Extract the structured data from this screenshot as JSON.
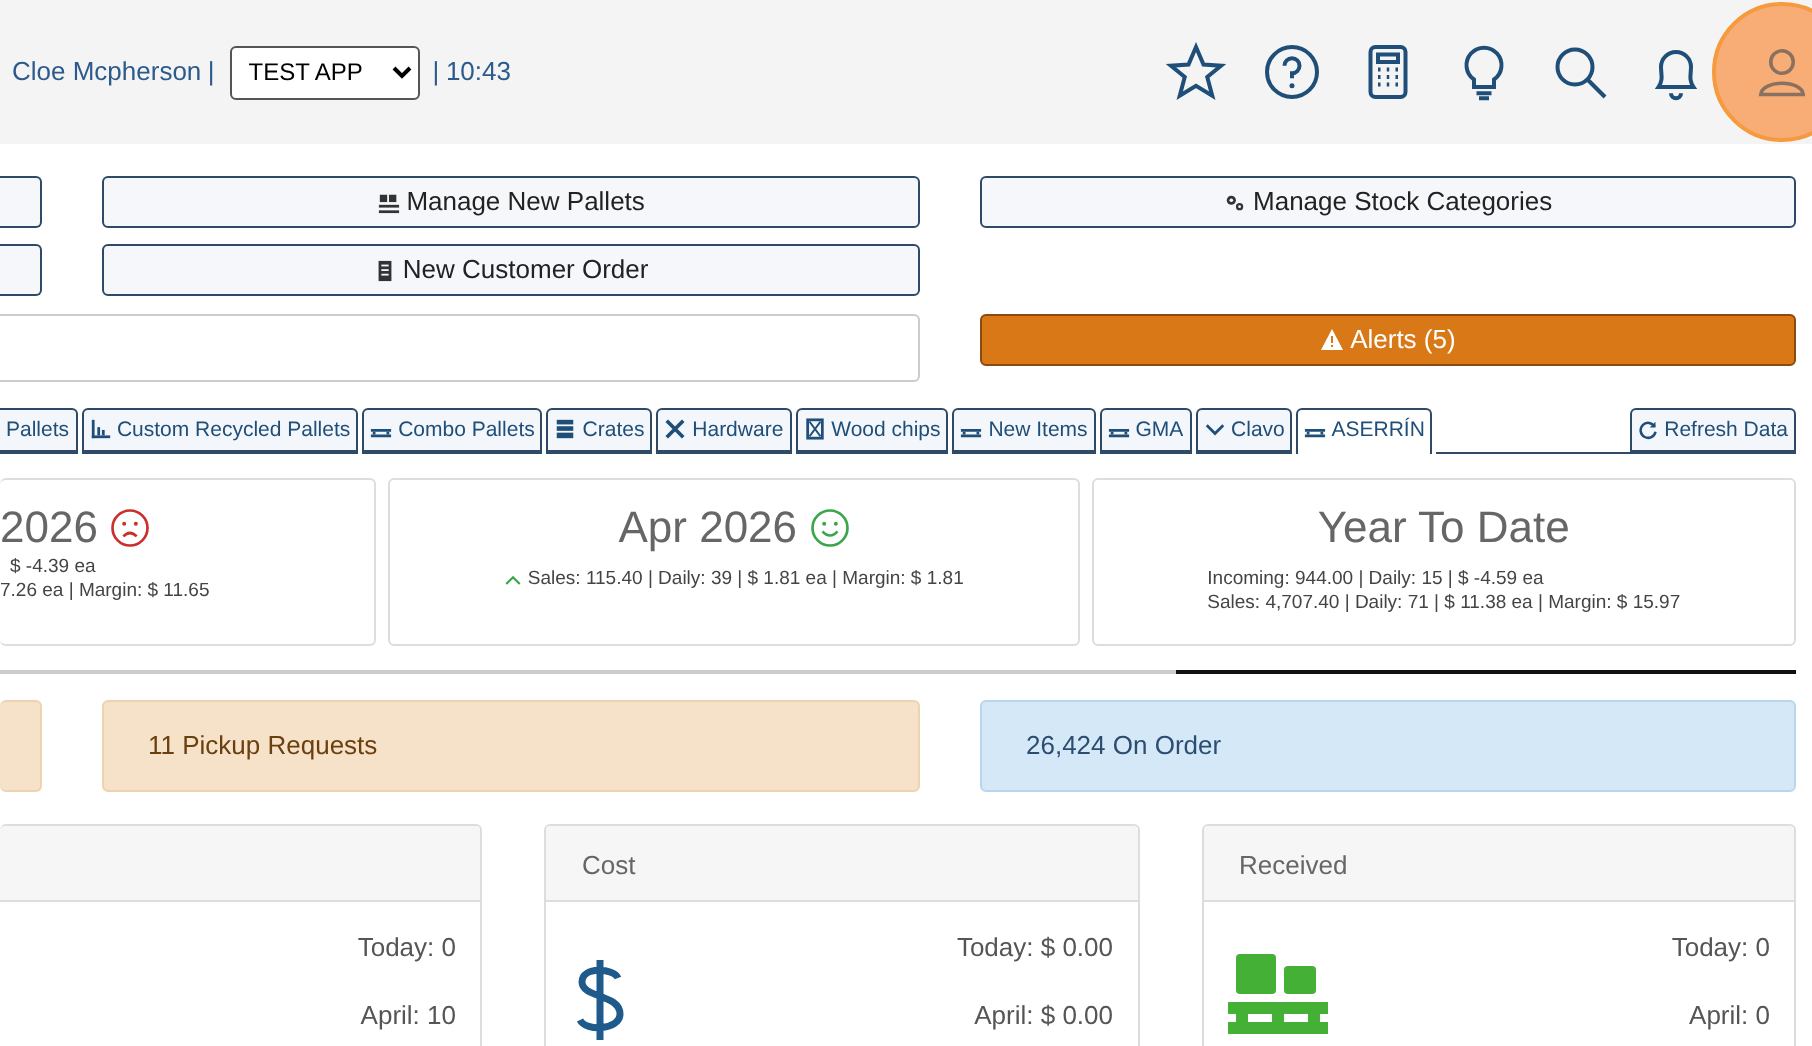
{
  "header": {
    "user": "Cloe Mcpherson",
    "separator_1": "|",
    "app_select": {
      "value": "TEST APP"
    },
    "separator_2": "|",
    "time": "10:43"
  },
  "action_buttons": [
    {
      "label": "Manage New Pallets"
    },
    {
      "label": "Manage Stock Categories"
    },
    {
      "label": "New Customer Order"
    }
  ],
  "alerts": {
    "label": "Alerts (5)"
  },
  "tabs": [
    {
      "label": "Pallets",
      "selected": false
    },
    {
      "label": "Custom Recycled Pallets",
      "selected": false
    },
    {
      "label": "Combo Pallets",
      "selected": false
    },
    {
      "label": "Crates",
      "selected": false
    },
    {
      "label": "Hardware",
      "selected": false
    },
    {
      "label": "Wood chips",
      "selected": false
    },
    {
      "label": "New Items",
      "selected": false
    },
    {
      "label": "GMA",
      "selected": false
    },
    {
      "label": "Clavo",
      "selected": false
    },
    {
      "label": "ASERRÍN",
      "selected": true
    }
  ],
  "refresh": {
    "label": "Refresh Data"
  },
  "summary_cards": [
    {
      "title": "2026",
      "lines": [
        "$ -4.39 ea",
        "7.26 ea | Margin: $ 11.65"
      ]
    },
    {
      "title": "Apr 2026",
      "lines": [
        "Sales: 115.40 | Daily: 39 | $ 1.81 ea | Margin: $ 1.81"
      ]
    },
    {
      "title": "Year To Date",
      "lines": [
        "Incoming: 944.00 | Daily: 15 | $ -4.59 ea",
        "Sales: 4,707.40 | Daily: 71 | $ 11.38 ea | Margin: $ 15.97"
      ]
    }
  ],
  "notices": [
    {
      "label": "11 Pickup Requests",
      "kind": "warning"
    },
    {
      "label": "26,424 On Order",
      "kind": "info"
    }
  ],
  "panels": [
    {
      "today": "Today: 0",
      "month": "April: 10"
    },
    {
      "title": "Cost",
      "today": "Today: $ 0.00",
      "month": "April: $ 0.00"
    },
    {
      "title": "Received",
      "today": "Today: 0",
      "month": "April: 0"
    }
  ]
}
